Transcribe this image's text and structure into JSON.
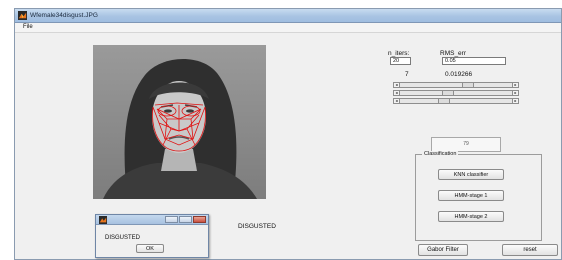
{
  "window": {
    "title": "Wfemale34disgust.JPG"
  },
  "menu": {
    "file_label": "File"
  },
  "params": {
    "n_iters_label": "n_iters:",
    "n_iters_value": "20",
    "rms_err_label": "RMS_err",
    "rms_err_value": "0.05",
    "current_iter": "7",
    "current_rms": "0.019266"
  },
  "sliders": [
    0.62,
    0.42,
    0.38
  ],
  "result_box": {
    "text": "79"
  },
  "classification": {
    "title": "Classification",
    "knn_label": "KNN classifier",
    "hmm1_label": "HMM-stage 1",
    "hmm2_label": "HMM-stage 2"
  },
  "status_text": "DISGUSTED",
  "buttons": {
    "gabor_label": "Gabor Filter",
    "reset_label": "reset"
  },
  "dialog": {
    "message": "DISGUSTED",
    "ok_label": "OK"
  },
  "icons": {
    "app": "matlab-icon"
  }
}
